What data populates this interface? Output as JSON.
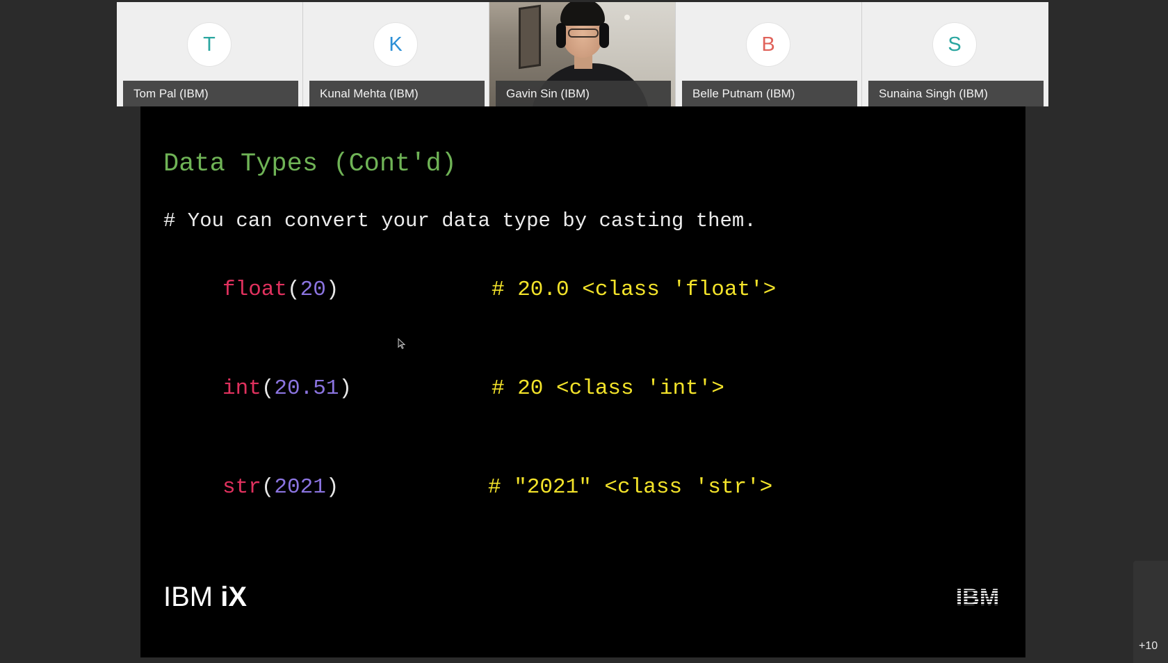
{
  "participants": [
    {
      "initial": "T",
      "name": "Tom Pal (IBM)",
      "initial_color": "#2aa6a0"
    },
    {
      "initial": "K",
      "name": "Kunal Mehta (IBM)",
      "initial_color": "#2b8fd6"
    },
    {
      "initial": "",
      "name": "Gavin Sin (IBM)",
      "initial_color": ""
    },
    {
      "initial": "B",
      "name": "Belle Putnam (IBM)",
      "initial_color": "#e0625a"
    },
    {
      "initial": "S",
      "name": "Sunaina Singh (IBM)",
      "initial_color": "#2aa6a0"
    }
  ],
  "slide": {
    "title": "Data Types (Cont'd)",
    "comment": "# You can convert your data type by casting them.",
    "examples": [
      {
        "fn": "float",
        "open": "(",
        "arg": "20",
        "close": ")",
        "result": "# 20.0 <class 'float'>"
      },
      {
        "fn": "int",
        "open": "(",
        "arg": "20.51",
        "close": ")",
        "result": "# 20 <class 'int'>"
      },
      {
        "fn": "str",
        "open": "(",
        "arg": "2021",
        "close": ")",
        "result": "# \"2021\" <class 'str'>"
      }
    ],
    "brand_left_a": "IBM ",
    "brand_left_b": "iX",
    "brand_right": "IBM"
  },
  "colors": {
    "title": "#6fb356",
    "function": "#e0315e",
    "number": "#8b74e0",
    "result": "#f3e32a"
  },
  "more_participants": "+10"
}
